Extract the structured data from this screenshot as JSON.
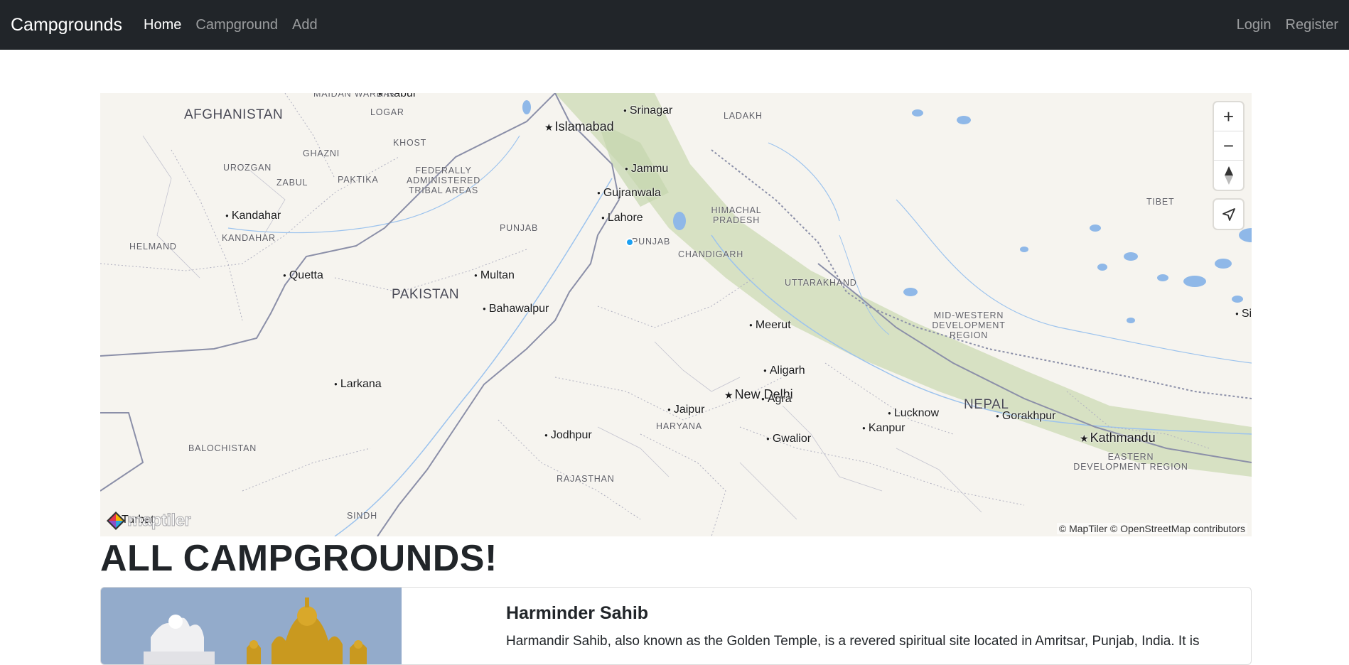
{
  "navbar": {
    "brand": "Campgrounds",
    "links": [
      {
        "label": "Home",
        "active": true
      },
      {
        "label": "Campground",
        "active": false
      },
      {
        "label": "Add",
        "active": false
      }
    ],
    "right_links": [
      {
        "label": "Login"
      },
      {
        "label": "Register"
      }
    ]
  },
  "map": {
    "countries": [
      "AFGHANISTAN",
      "PAKISTAN",
      "NEPAL"
    ],
    "capitals": [
      "Islamabad",
      "New Delhi",
      "Kathmandu",
      "Kabul"
    ],
    "cities": [
      "Srinagar",
      "Jammu",
      "Gujranwala",
      "Lahore",
      "Kandahar",
      "Quetta",
      "Multan",
      "Bahawalpur",
      "Larkana",
      "Meerut",
      "Aligarh",
      "Agra",
      "Jaipur",
      "Jodhpur",
      "Lucknow",
      "Kanpur",
      "Gorakhpur",
      "Gwalior",
      "Turbat",
      "Si"
    ],
    "regions": [
      "MAIDAN WARDAK",
      "LOGAR",
      "KHOST",
      "GHAZNI",
      "UROZGAN",
      "ZABUL",
      "PAKTIKA",
      "FEDERALLY ADMINISTERED TRIBAL AREAS",
      "HELMAND",
      "KANDAHAR",
      "PUNJAB",
      "PUNJAB",
      "LADAKH",
      "HIMACHAL PRADESH",
      "CHANDIGARH",
      "UTTARAKHAND",
      "TIBET",
      "MID-WESTERN DEVELOPMENT REGION",
      "EASTERN DEVELOPMENT REGION",
      "HARYANA",
      "RAJASTHAN",
      "BALOCHISTAN",
      "SINDH"
    ],
    "controls": {
      "zoom_in": "+",
      "zoom_out": "−"
    },
    "attribution": "© MapTiler © OpenStreetMap contributors",
    "logo_text": "maptiler",
    "colors": {
      "land": "#f6f4ef",
      "forest": "#cfdcb8",
      "water": "#8fb8e8",
      "border": "#8b8fa8"
    }
  },
  "page": {
    "heading": "ALL CAMPGROUNDS!"
  },
  "campgrounds": [
    {
      "title": "Harminder Sahib",
      "description": "Harmandir Sahib, also known as the Golden Temple, is a revered spiritual site located in Amritsar, Punjab, India. It is"
    }
  ]
}
